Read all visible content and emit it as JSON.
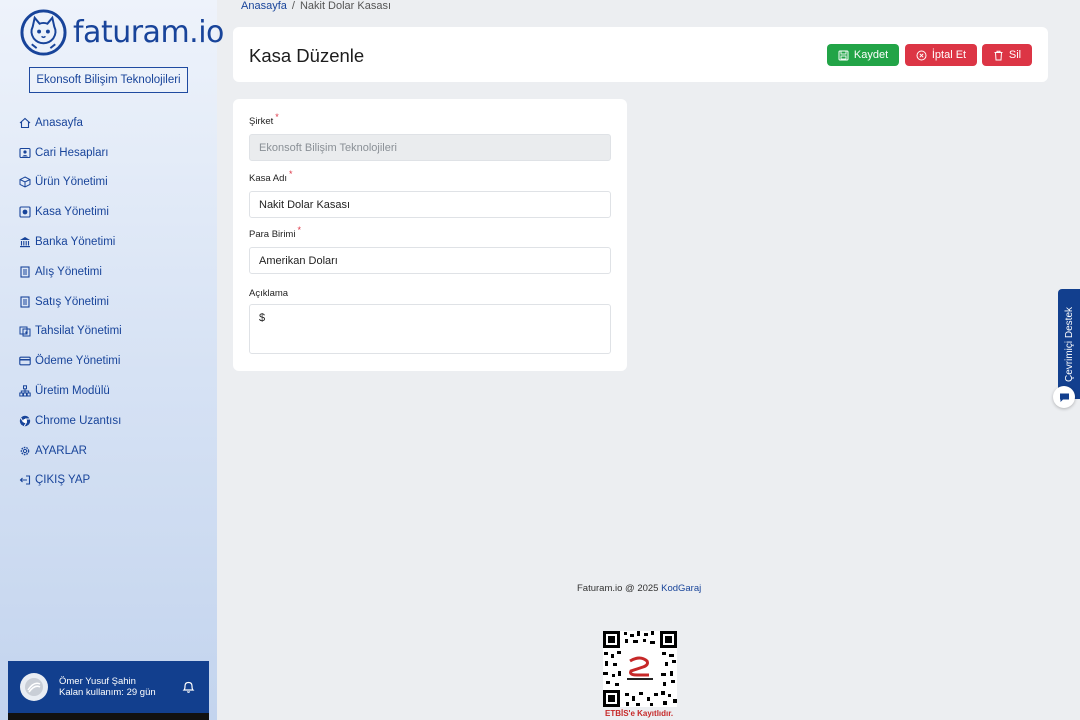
{
  "app": {
    "brand": "faturam.io",
    "company": "Ekonsoft Bilişim Teknolojileri"
  },
  "sidebar": {
    "items": [
      {
        "label": "Anasayfa",
        "icon": "home-icon"
      },
      {
        "label": "Cari Hesapları",
        "icon": "users-icon"
      },
      {
        "label": "Ürün Yönetimi",
        "icon": "box-icon"
      },
      {
        "label": "Kasa Yönetimi",
        "icon": "safe-icon"
      },
      {
        "label": "Banka Yönetimi",
        "icon": "bank-icon"
      },
      {
        "label": "Alış Yönetimi",
        "icon": "receipt-icon"
      },
      {
        "label": "Satış Yönetimi",
        "icon": "receipt-icon"
      },
      {
        "label": "Tahsilat Yönetimi",
        "icon": "cash-icon"
      },
      {
        "label": "Ödeme Yönetimi",
        "icon": "card-icon"
      },
      {
        "label": "Üretim Modülü",
        "icon": "sitemap-icon"
      },
      {
        "label": "Chrome Uzantısı",
        "icon": "chrome-icon"
      },
      {
        "label": "AYARLAR",
        "icon": "gear-icon"
      },
      {
        "label": "ÇIKIŞ YAP",
        "icon": "logout-icon"
      }
    ]
  },
  "user": {
    "name": "Ömer Yusuf Şahin",
    "remaining": "Kalan kullanım: 29 gün"
  },
  "breadcrumb": {
    "home": "Anasayfa",
    "separator": "/",
    "current": "Nakit Dolar Kasası"
  },
  "header": {
    "title": "Kasa Düzenle",
    "save_label": "Kaydet",
    "cancel_label": "İptal Et",
    "delete_label": "Sil"
  },
  "form": {
    "company_label": "Şirket",
    "company_value": "Ekonsoft Bilişim Teknolojileri",
    "name_label": "Kasa Adı",
    "name_value": "Nakit Dolar Kasası",
    "currency_label": "Para Birimi",
    "currency_value": "Amerikan Doları",
    "description_label": "Açıklama",
    "description_value": "$",
    "required_mark": "*"
  },
  "footer": {
    "text": "Faturam.io @ 2025",
    "link": "KodGaraj",
    "etbis": "ETBİS'e Kayıtlıdır."
  },
  "support": {
    "label": "Çevrimiçi Destek"
  },
  "colors": {
    "brand": "#18449a",
    "success": "#22a447",
    "danger": "#dc3545"
  }
}
